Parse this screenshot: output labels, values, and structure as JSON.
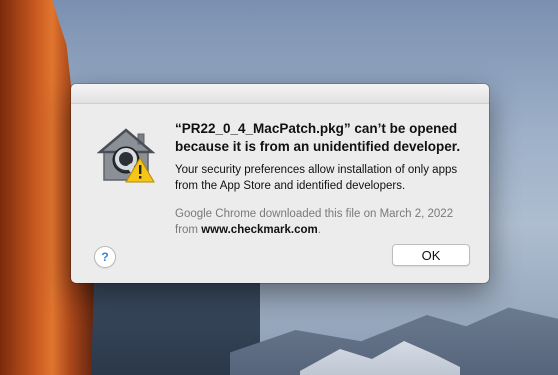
{
  "dialog": {
    "icon": "gatekeeper-security-house-warning-icon",
    "title": "“PR22_0_4_MacPatch.pkg” can’t be opened because it is from an unidentified developer.",
    "message": "Your security preferences allow installation of only apps from the App Store and identified developers.",
    "source_prefix": "Google Chrome downloaded this file on March 2, 2022 from ",
    "source_domain": "www.checkmark.com",
    "source_suffix": ".",
    "help_label": "?",
    "ok_label": "OK"
  },
  "colors": {
    "dialog_background": "#ececec",
    "secondary_text": "#7a7a7a",
    "help_accent": "#3b83d6"
  }
}
